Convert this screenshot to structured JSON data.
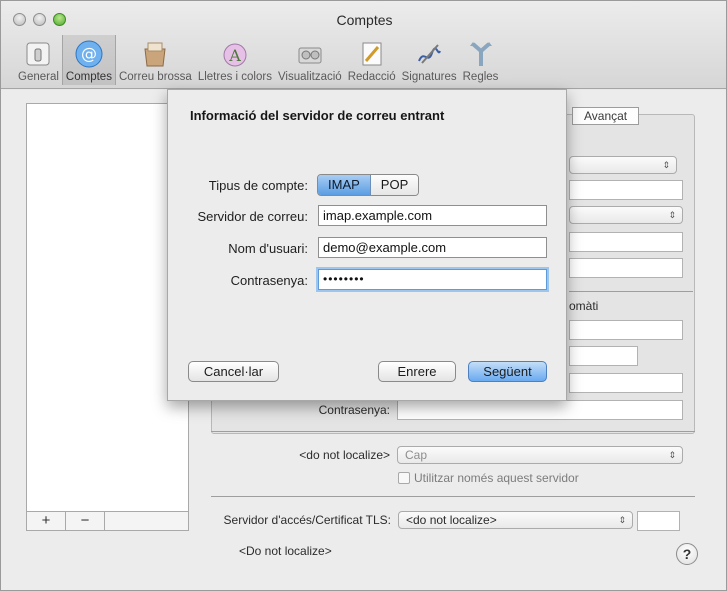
{
  "window": {
    "title": "Comptes"
  },
  "toolbar": {
    "items": [
      {
        "label": "General",
        "icon": "general-switch-icon"
      },
      {
        "label": "Comptes",
        "icon": "at-sign-icon"
      },
      {
        "label": "Correu brossa",
        "icon": "junk-mail-icon"
      },
      {
        "label": "Lletres i colors",
        "icon": "fonts-colors-icon"
      },
      {
        "label": "Visualització",
        "icon": "viewing-icon"
      },
      {
        "label": "Redacció",
        "icon": "composing-icon"
      },
      {
        "label": "Signatures",
        "icon": "signatures-icon"
      },
      {
        "label": "Regles",
        "icon": "rules-icon"
      }
    ]
  },
  "accounts_panel": {
    "add_label": "+",
    "remove_label": "−"
  },
  "tabs": {
    "advanced": "Avançat"
  },
  "background_form": {
    "password_label": "Contrasenya:",
    "auth_label": "<do not localize>",
    "auth_value": "Cap",
    "only_server_label": "Utilitzar només aquest servidor",
    "ssl_label": "Servidor d'accés/Certificat TLS:",
    "ssl_value": "<do not localize>",
    "footer_label": "<Do not localize>",
    "auto_detect_fragment": "omàti",
    "help_label": "?"
  },
  "sheet": {
    "title": "Informació del servidor de correu entrant",
    "account_type_label": "Tipus de compte:",
    "account_type_options": [
      "IMAP",
      "POP"
    ],
    "account_type_selected": "IMAP",
    "server_label": "Servidor de correu:",
    "server_value": "imap.example.com",
    "username_label": "Nom d'usuari:",
    "username_value": "demo@example.com",
    "password_label": "Contrasenya:",
    "password_value": "••••••••",
    "cancel_label": "Cancel·lar",
    "back_label": "Enrere",
    "next_label": "Següent"
  },
  "colors": {
    "accent": "#5b9de3",
    "window_bg": "#ececec",
    "focus_ring": "#9cc6ee"
  }
}
